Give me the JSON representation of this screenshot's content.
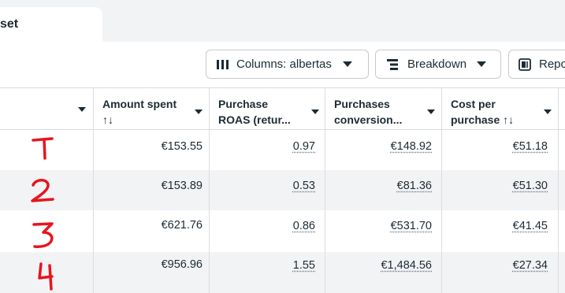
{
  "tab": {
    "label": "set"
  },
  "toolbar": {
    "columns_label": "Columns: albertas",
    "breakdown_label": "Breakdown",
    "reports_label": "Repo"
  },
  "table": {
    "headers": [
      {
        "line1": "",
        "line2": ""
      },
      {
        "line1": "Amount spent",
        "line2": "↑↓"
      },
      {
        "line1": "Purchase",
        "line2": "ROAS (retur..."
      },
      {
        "line1": "Purchases",
        "line2": "conversion..."
      },
      {
        "line1": "Cost per",
        "line2": "purchase ↑↓"
      }
    ],
    "rows": [
      {
        "annotation": "1",
        "amount_spent": "€153.55",
        "roas": "0.97",
        "conversion": "€148.92",
        "cost_per_purchase": "€51.18"
      },
      {
        "annotation": "2",
        "amount_spent": "€153.89",
        "roas": "0.53",
        "conversion": "€81.36",
        "cost_per_purchase": "€51.30"
      },
      {
        "annotation": "3",
        "amount_spent": "€621.76",
        "roas": "0.86",
        "conversion": "€531.70",
        "cost_per_purchase": "€41.45"
      },
      {
        "annotation": "4",
        "amount_spent": "€956.96",
        "roas": "1.55",
        "conversion": "€1,484.56",
        "cost_per_purchase": "€27.34"
      }
    ]
  },
  "colors": {
    "annotation": "#e8141e",
    "border": "#dadde1",
    "alt_row": "#f2f3f5"
  }
}
